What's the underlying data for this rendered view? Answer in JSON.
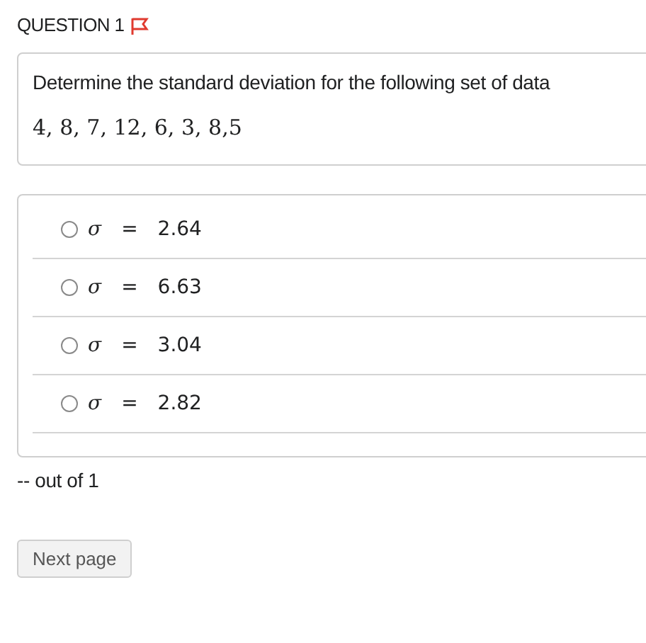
{
  "question": {
    "label": "QUESTION 1",
    "flagged": true
  },
  "prompt": {
    "text": "Determine the standard deviation for the following set of data",
    "data": "4, 8, 7, 12, 6, 3, 8,5"
  },
  "options": [
    {
      "symbol": "σ",
      "relation": "=",
      "value": "2.64",
      "selected": false
    },
    {
      "symbol": "σ",
      "relation": "=",
      "value": "6.63",
      "selected": false
    },
    {
      "symbol": "σ",
      "relation": "=",
      "value": "3.04",
      "selected": false
    },
    {
      "symbol": "σ",
      "relation": "=",
      "value": "2.82",
      "selected": false
    }
  ],
  "score": "-- out of 1",
  "next_button": "Next page"
}
